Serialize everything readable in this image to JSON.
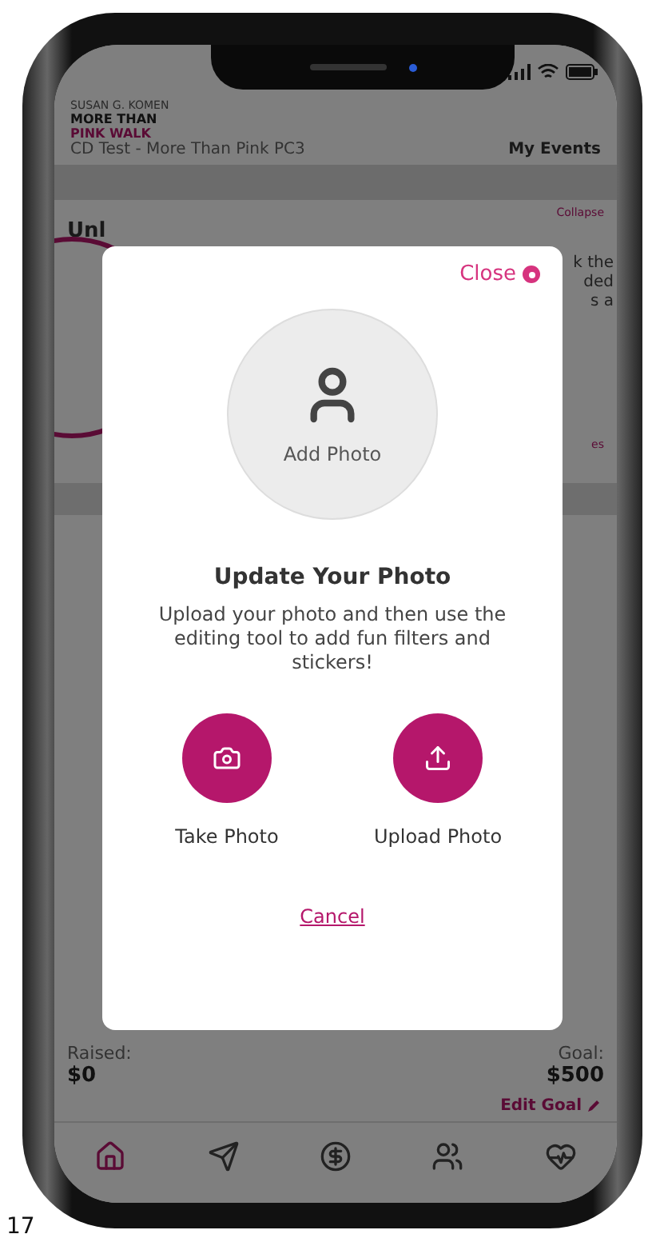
{
  "header": {
    "org": "SUSAN G. KOMEN",
    "logo_lines": [
      "MORE THAN",
      "PINK WALK"
    ],
    "event": "CD Test - More Than Pink PC3",
    "menu": "My Events"
  },
  "background": {
    "collapse_link": "Collapse",
    "section_title": "Unl",
    "side_text": [
      "k the",
      "ded",
      "s a"
    ],
    "link_2": "es"
  },
  "modal": {
    "close": "Close",
    "add_photo": "Add Photo",
    "title": "Update Your Photo",
    "body": "Upload your photo and then use the editing tool to add fun filters and stickers!",
    "actions": [
      {
        "kind": "camera",
        "label": "Take Photo"
      },
      {
        "kind": "upload",
        "label": "Upload Photo"
      }
    ],
    "cancel": "Cancel"
  },
  "progress": {
    "raised_label": "Raised:",
    "raised": "$0",
    "goal_label": "Goal:",
    "goal": "$500",
    "edit": "Edit Goal"
  },
  "tabs": [
    {
      "selected": true
    },
    {
      "selected": false
    },
    {
      "selected": false
    },
    {
      "selected": false
    },
    {
      "selected": false
    }
  ],
  "page_number": "17"
}
